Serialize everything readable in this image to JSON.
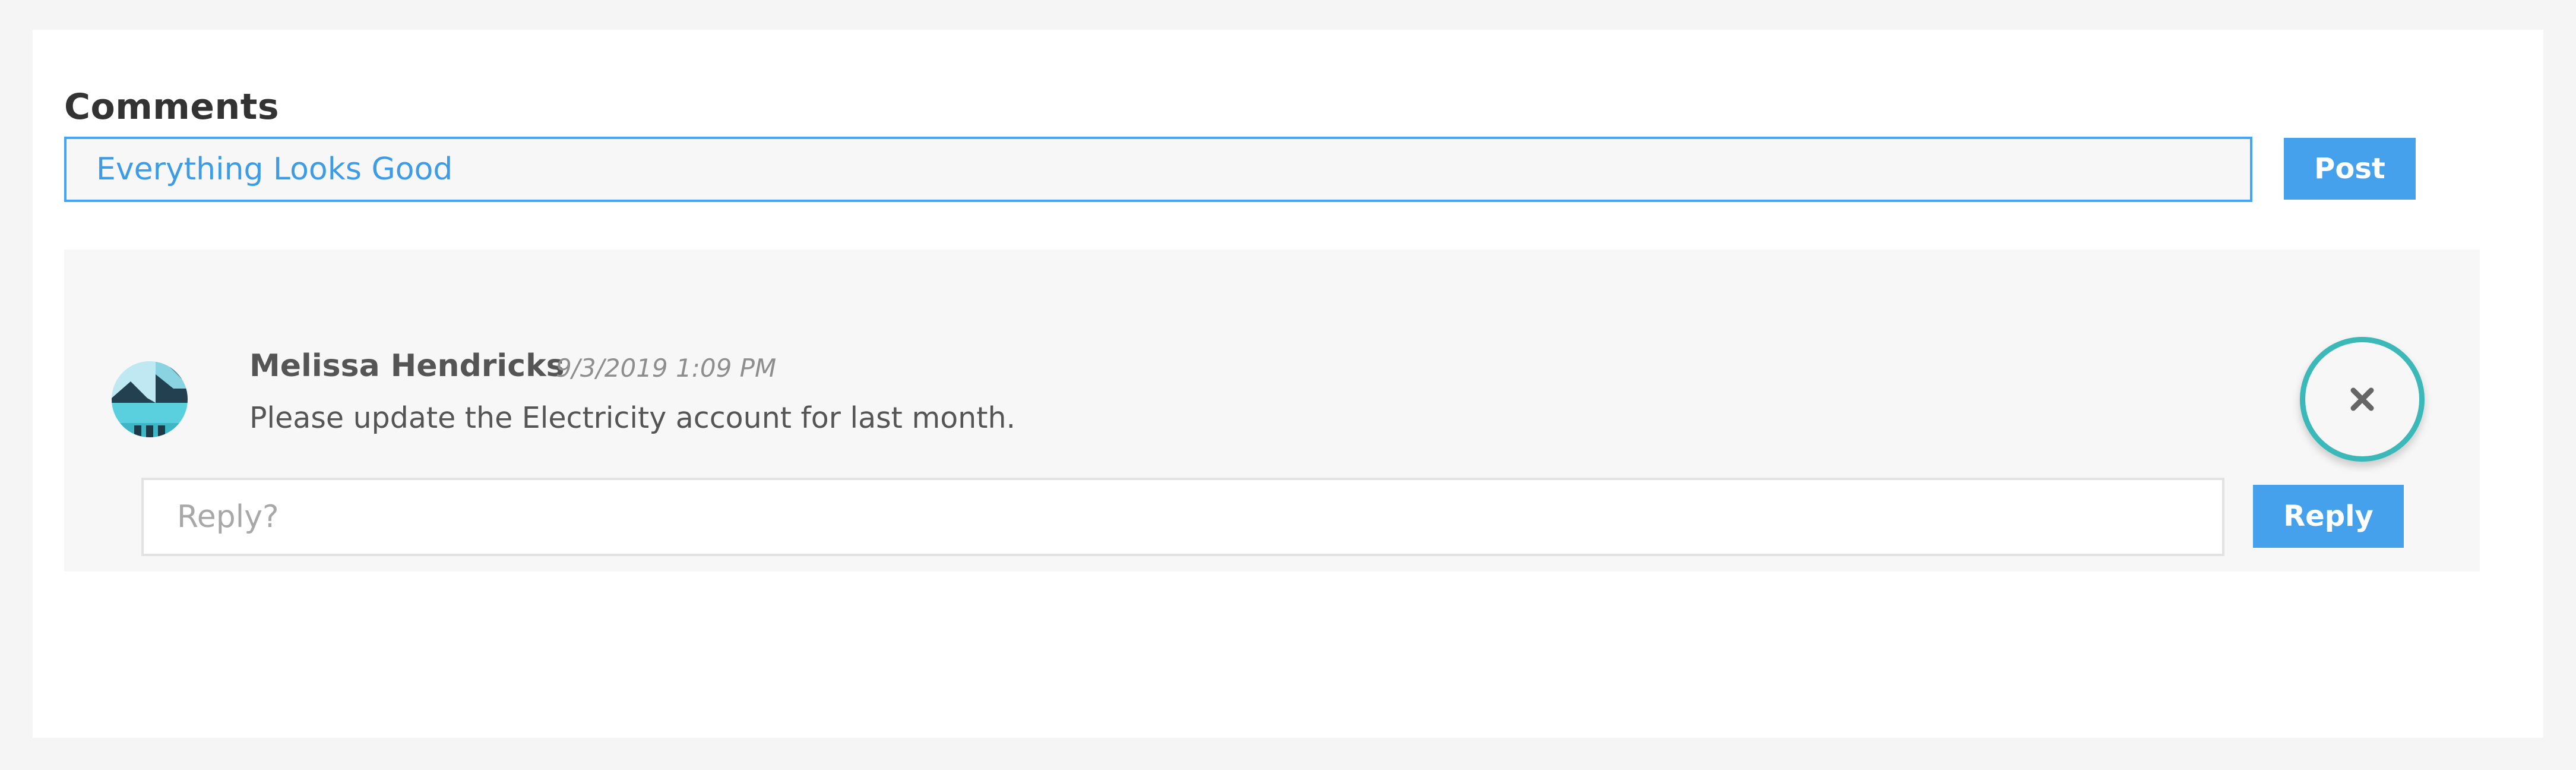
{
  "comments": {
    "heading": "Comments",
    "new_comment": {
      "value": "Everything Looks Good",
      "post_label": "Post"
    },
    "thread": [
      {
        "author": "Melissa Hendricks",
        "timestamp": "9/3/2019 1:09 PM",
        "message": "Please update the Electricity account for last month.",
        "avatar_icon": "landscape-avatar-icon",
        "delete_icon": "close-icon",
        "reply": {
          "placeholder": "Reply?",
          "button_label": "Reply"
        }
      }
    ]
  },
  "colors": {
    "accent": "#45a1ec",
    "input_border": "#42a5f5",
    "highlight_ring": "#3bb8b8",
    "heading_text": "#333333",
    "body_text": "#555555"
  }
}
